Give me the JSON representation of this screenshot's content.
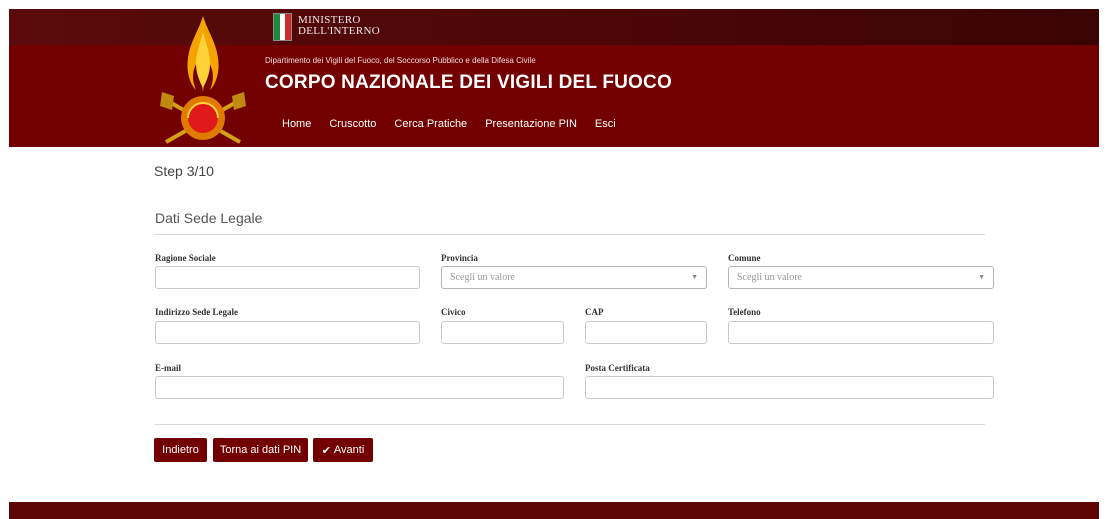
{
  "header": {
    "ministero_line1": "MINISTERO",
    "ministero_line2": "DELL'INTERNO",
    "department": "Dipartimento dei Vigili del Fuoco, del Soccorso Pubblico e della Difesa Civile",
    "title": "CORPO NAZIONALE DEI VIGILI DEL FUOCO",
    "nav": [
      "Home",
      "Cruscotto",
      "Cerca Pratiche",
      "Presentazione PIN",
      "Esci"
    ]
  },
  "form": {
    "step": "Step 3/10",
    "section_title": "Dati Sede Legale",
    "labels": {
      "ragione_sociale": "Ragione Sociale",
      "provincia": "Provincia",
      "comune": "Comune",
      "indirizzo": "Indirizzo Sede Legale",
      "civico": "Civico",
      "cap": "CAP",
      "telefono": "Telefono",
      "email": "E-mail",
      "pec": "Posta Certificata"
    },
    "values": {
      "ragione_sociale": "",
      "indirizzo": "",
      "civico": "",
      "cap": "",
      "telefono": "",
      "email": "",
      "pec": ""
    },
    "select_placeholder": "Scegli un valore"
  },
  "buttons": {
    "back": "Indietro",
    "pin": "Torna ai dati PIN",
    "next": "Avanti"
  },
  "icons": {
    "next": "checkmark-icon",
    "select": "caret-down-icon",
    "logo": "vigili-del-fuoco-emblem",
    "flag": "italian-flag"
  },
  "colors": {
    "brand": "#730000",
    "topbar": "#4a0606",
    "flag_green": "#1f8a3b",
    "flag_white": "#ffffff",
    "flag_red": "#cf2b2b"
  }
}
